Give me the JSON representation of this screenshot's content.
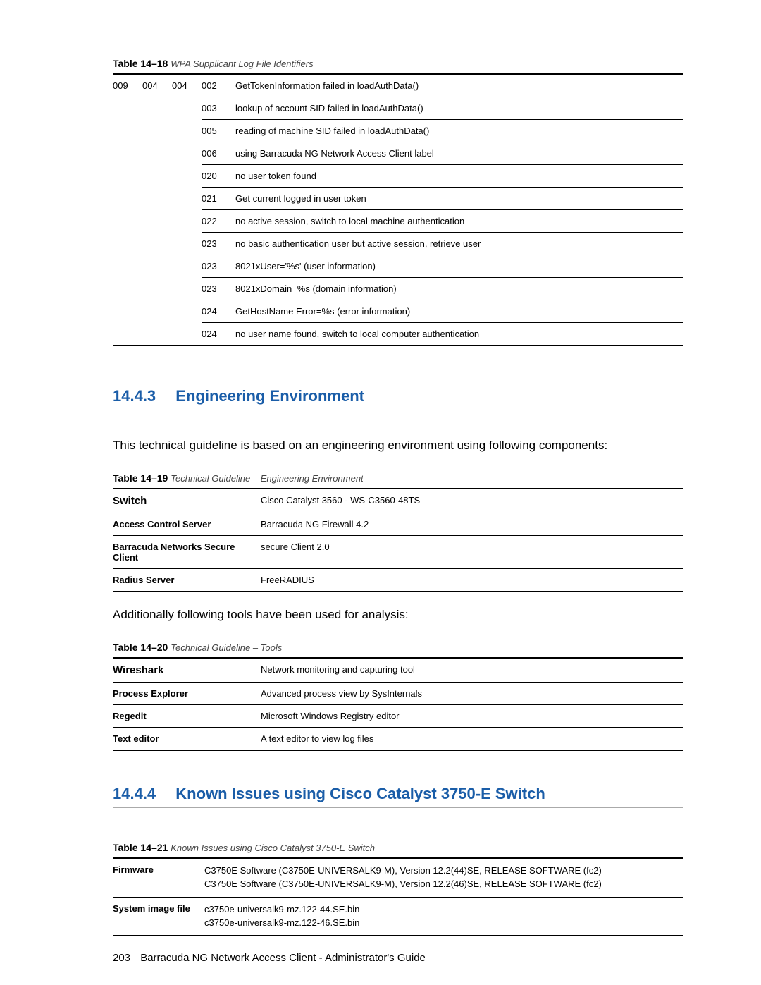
{
  "table18": {
    "caption_num": "Table 14–18",
    "caption_title": "WPA Supplicant Log File Identifiers",
    "left": {
      "c1": "009",
      "c2": "004",
      "c3": "004"
    },
    "rows": [
      {
        "code": "002",
        "msg": "GetTokenInformation failed in loadAuthData()"
      },
      {
        "code": "003",
        "msg": "lookup of account SID failed in loadAuthData()"
      },
      {
        "code": "005",
        "msg": "reading of machine SID failed in loadAuthData()"
      },
      {
        "code": "006",
        "msg": "using Barracuda NG Network Access Client label"
      },
      {
        "code": "020",
        "msg": "no user token found"
      },
      {
        "code": "021",
        "msg": "Get current logged in user token"
      },
      {
        "code": "022",
        "msg": "no active session, switch to local machine authentication"
      },
      {
        "code": "023",
        "msg": "no basic authentication user but active session, retrieve user"
      },
      {
        "code": "023",
        "msg": "8021xUser='%s' (user information)"
      },
      {
        "code": "023",
        "msg": "8021xDomain=%s (domain information)"
      },
      {
        "code": "024",
        "msg": "GetHostName Error=%s (error information)"
      },
      {
        "code": "024",
        "msg": "no user name found, switch to local computer authentication"
      }
    ]
  },
  "section1": {
    "num": "14.4.3",
    "title": "Engineering Environment",
    "intro": "This technical guideline is based on an engineering environment using following components:"
  },
  "table19": {
    "caption_num": "Table 14–19",
    "caption_title": "Technical Guideline – Engineering Environment",
    "rows": [
      {
        "k": "Switch",
        "v": "Cisco Catalyst 3560 - WS-C3560-48TS",
        "first": true
      },
      {
        "k": "Access Control Server",
        "v": "Barracuda NG Firewall 4.2"
      },
      {
        "k": "Barracuda Networks Secure Client",
        "v": "secure Client 2.0"
      },
      {
        "k": "Radius Server",
        "v": "FreeRADIUS"
      }
    ]
  },
  "tools_intro": "Additionally following tools have been used for analysis:",
  "table20": {
    "caption_num": "Table 14–20",
    "caption_title": "Technical Guideline – Tools",
    "rows": [
      {
        "k": "Wireshark",
        "v": "Network monitoring and capturing tool",
        "first": true
      },
      {
        "k": "Process Explorer",
        "v": "Advanced process view by SysInternals"
      },
      {
        "k": "Regedit",
        "v": "Microsoft Windows Registry editor"
      },
      {
        "k": "Text editor",
        "v": "A text editor to view log files"
      }
    ]
  },
  "section2": {
    "num": "14.4.4",
    "title": "Known Issues using Cisco Catalyst 3750-E Switch"
  },
  "table21": {
    "caption_num": "Table 14–21",
    "caption_title": "Known Issues using Cisco Catalyst 3750-E Switch",
    "rows": [
      {
        "k": "Firmware",
        "v": "C3750E Software (C3750E-UNIVERSALK9-M), Version 12.2(44)SE, RELEASE SOFTWARE (fc2)\nC3750E Software (C3750E-UNIVERSALK9-M), Version 12.2(46)SE, RELEASE SOFTWARE (fc2)"
      },
      {
        "k": "System image file",
        "v": "c3750e-universalk9-mz.122-44.SE.bin\nc3750e-universalk9-mz.122-46.SE.bin"
      }
    ]
  },
  "footer": {
    "page": "203",
    "title": "Barracuda NG Network Access Client - Administrator's Guide"
  }
}
